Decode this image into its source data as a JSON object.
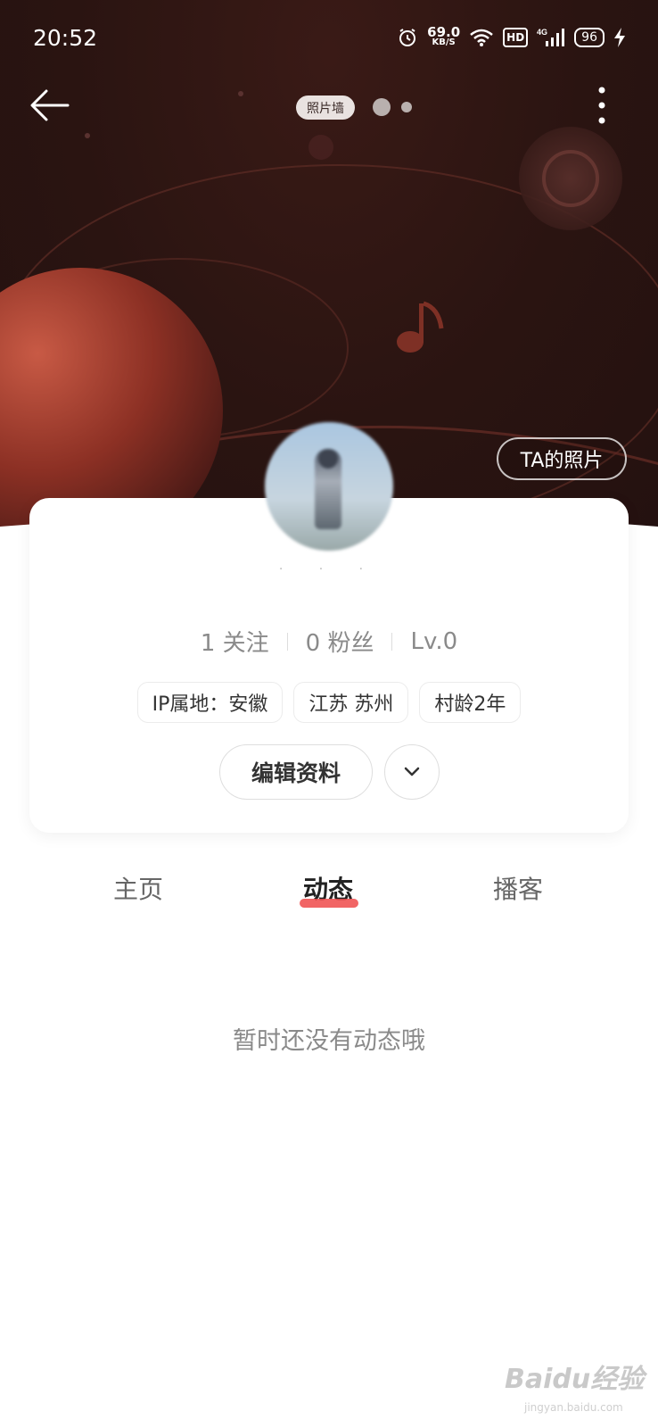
{
  "status_bar": {
    "time": "20:52",
    "net_speed_value": "69.0",
    "net_speed_unit": "KB/S",
    "hd": "HD",
    "network": "4G",
    "battery": "96",
    "icons": [
      "alarm-icon",
      "wifi-icon",
      "signal-icon",
      "charging-icon"
    ]
  },
  "header": {
    "photo_wall_label": "照片墙",
    "ta_photos_button": "TA的照片",
    "icons": [
      "back-arrow-icon",
      "more-vertical-icon"
    ]
  },
  "profile": {
    "stats": [
      {
        "label": "1 关注"
      },
      {
        "label": "0 粉丝"
      },
      {
        "label": "Lv.0"
      }
    ],
    "tags": [
      "IP属地：安徽",
      "江苏 苏州",
      "村龄2年"
    ],
    "edit_button": "编辑资料"
  },
  "tabs": [
    {
      "label": "主页",
      "active": false
    },
    {
      "label": "动态",
      "active": true
    },
    {
      "label": "播客",
      "active": false
    }
  ],
  "empty_state": "暂时还没有动态哦",
  "watermark": {
    "text": "Baidu经验",
    "url": "jingyan.baidu.com"
  },
  "colors": {
    "hero_bg": "#2a1411",
    "accent": "#ef4a4a"
  }
}
